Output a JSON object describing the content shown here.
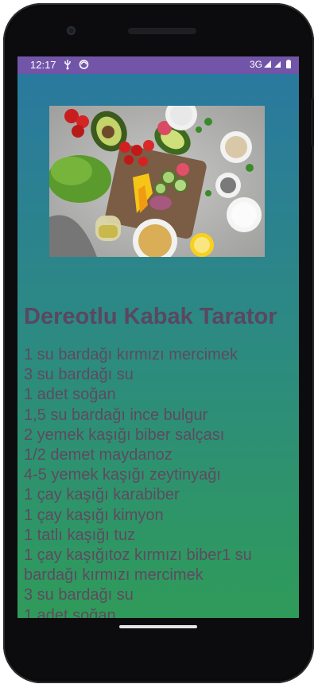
{
  "status_bar": {
    "time": "12:17",
    "network": "3G",
    "icons": [
      "usb-icon",
      "sync-icon",
      "wifi-icon",
      "signal-icon",
      "battery-icon"
    ]
  },
  "recipe": {
    "image_alt": "Salad ingredients on stone table",
    "title": "Dereotlu Kabak Tarator",
    "ingredients": [
      "1 su bardağı kırmızı mercimek",
      "3 su bardağı su",
      "1 adet soğan",
      "1,5 su bardağı ince bulgur",
      "2 yemek kaşığı biber salçası",
      "1/2 demet maydanoz",
      "4-5 yemek kaşığı zeytinyağı",
      "1 çay kaşığı karabiber",
      "1 çay kaşığı kimyon",
      "1 tatlı kaşığı tuz",
      "1 çay kaşığıtoz kırmızı biber1 su bardağı kırmızı mercimek",
      "3 su bardağı su",
      "1 adet soğan"
    ]
  },
  "colors": {
    "status_bar": "#7255a8",
    "gradient_top": "#2a78a0",
    "gradient_bottom": "#2f9b59",
    "text": "#5a4760"
  }
}
